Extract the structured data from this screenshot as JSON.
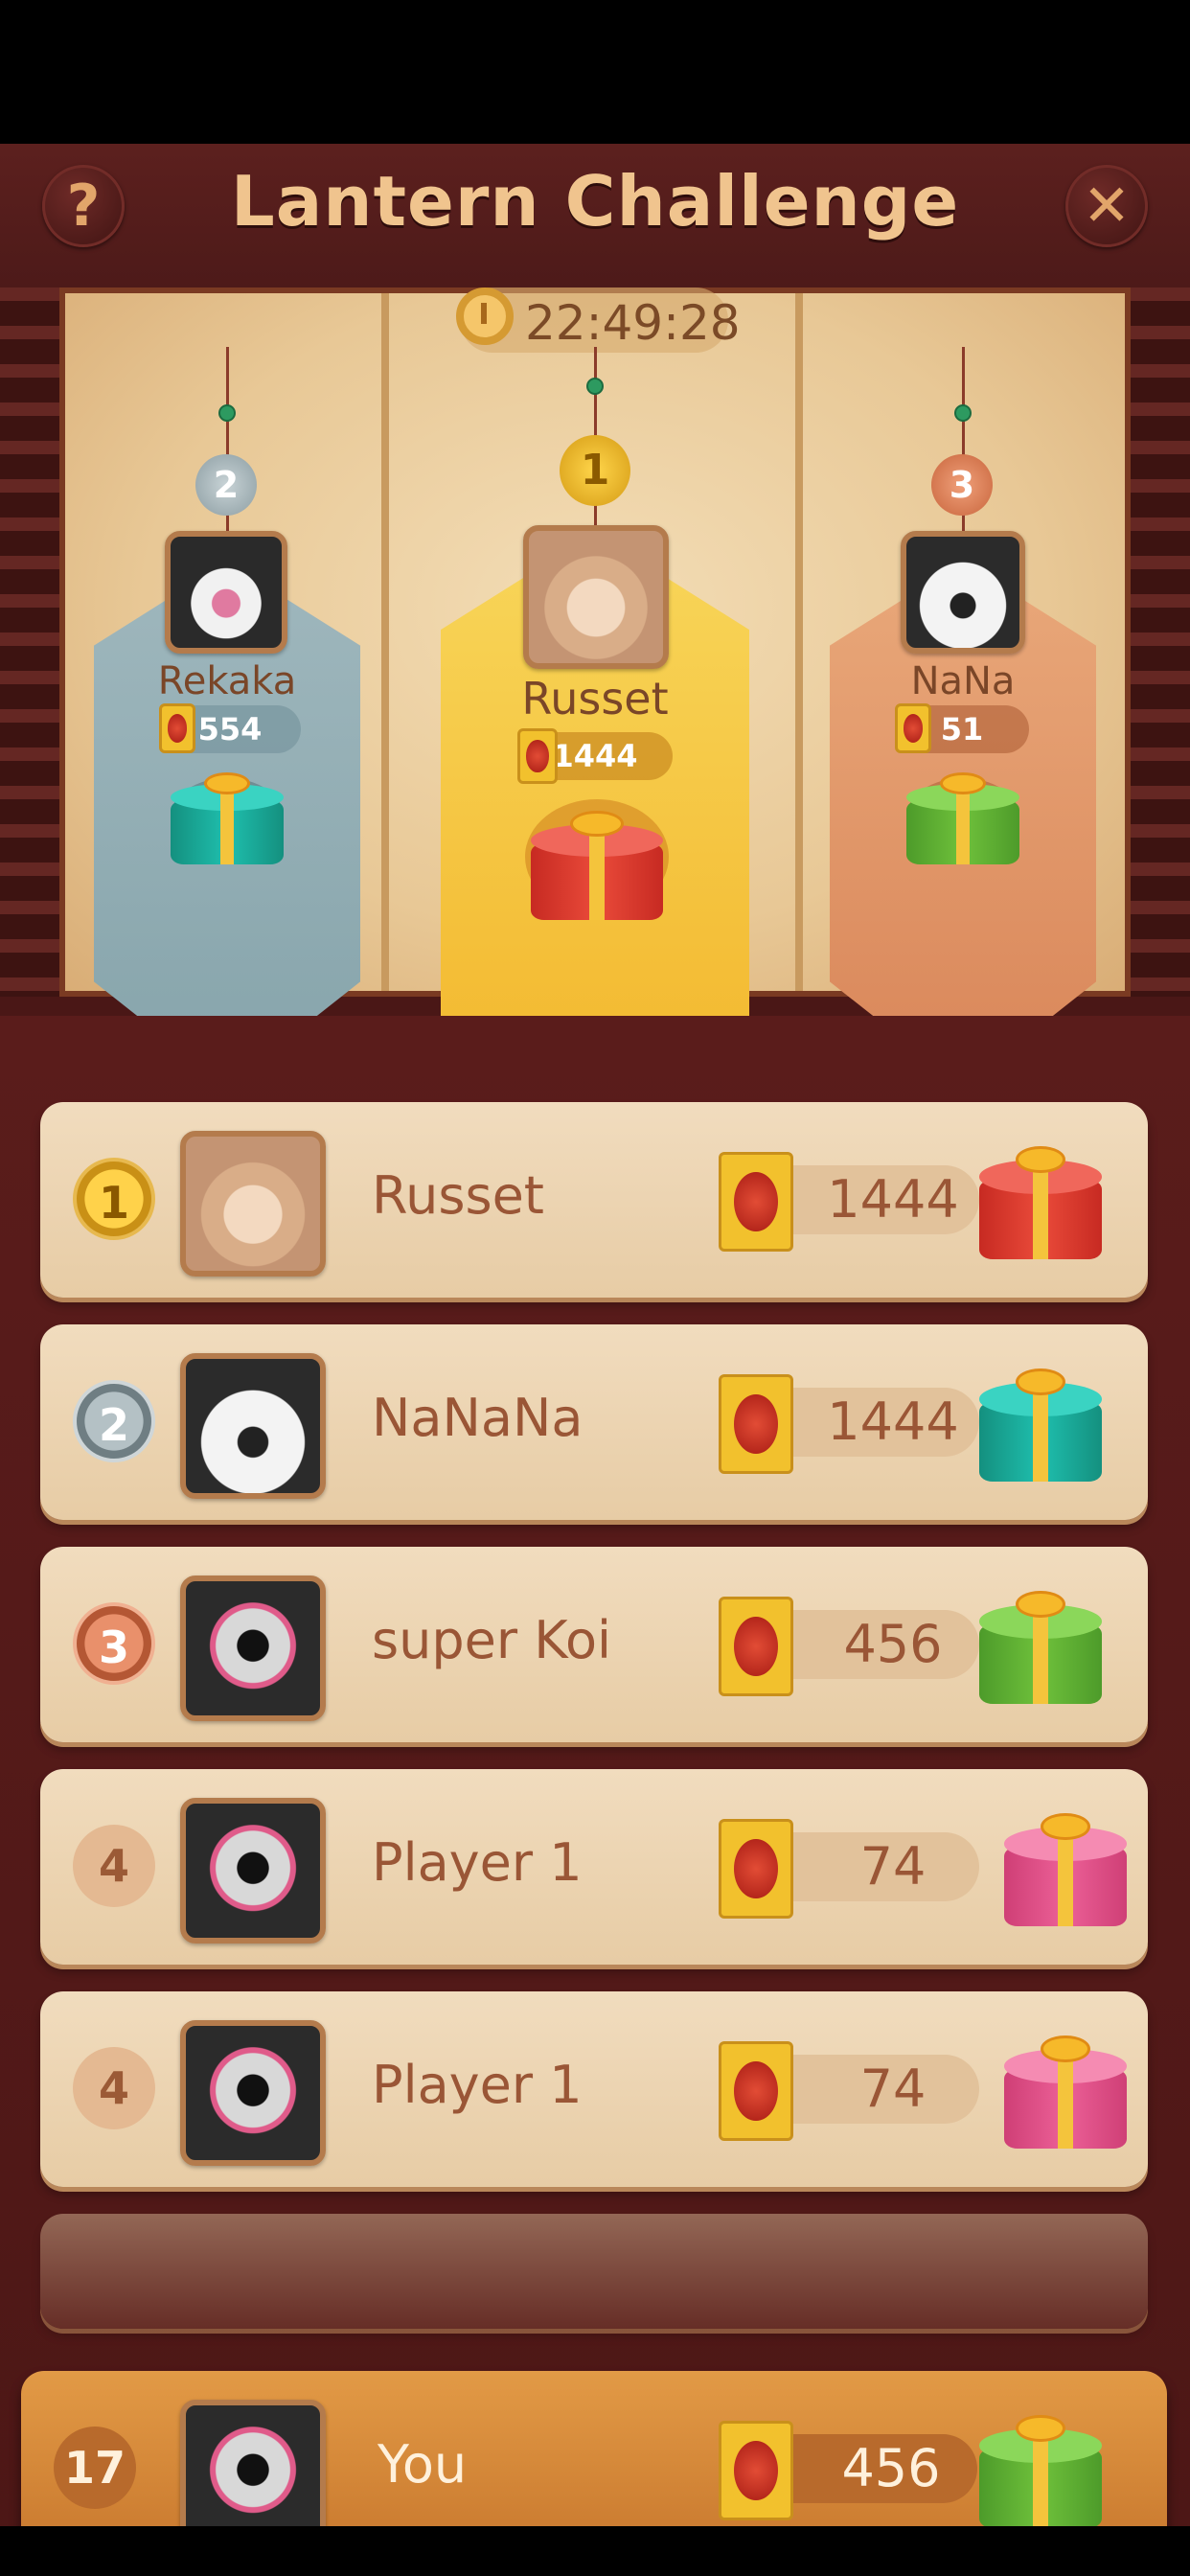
{
  "header": {
    "title": "Lantern Challenge",
    "help_icon": "?",
    "close_icon": "✕"
  },
  "timer": "22:49:28",
  "podium": [
    {
      "rank": "2",
      "name": "Rekaka",
      "score": "554",
      "gift": "teal"
    },
    {
      "rank": "1",
      "name": "Russet",
      "score": "1444",
      "gift": "red"
    },
    {
      "rank": "3",
      "name": "NaNa",
      "score": "51",
      "gift": "green"
    }
  ],
  "rows": [
    {
      "rank": "1",
      "name": "Russet",
      "score": "1444",
      "gift": "red"
    },
    {
      "rank": "2",
      "name": "NaNaNa",
      "score": "1444",
      "gift": "teal"
    },
    {
      "rank": "3",
      "name": "super Koi",
      "score": "456",
      "gift": "green"
    },
    {
      "rank": "4",
      "name": "Player 1",
      "score": "74",
      "gift": "pink"
    },
    {
      "rank": "4",
      "name": "Player 1",
      "score": "74",
      "gift": "pink"
    }
  ],
  "you": {
    "rank": "17",
    "name": "You",
    "score": "456",
    "gift": "green"
  },
  "colors": {
    "title": "#f0c48e",
    "row_bg": "#ecd4b2",
    "you_bg": "#d68a3b",
    "gold": "#f2b52a",
    "silver": "#8fa9b0",
    "bronze": "#de8e60"
  }
}
